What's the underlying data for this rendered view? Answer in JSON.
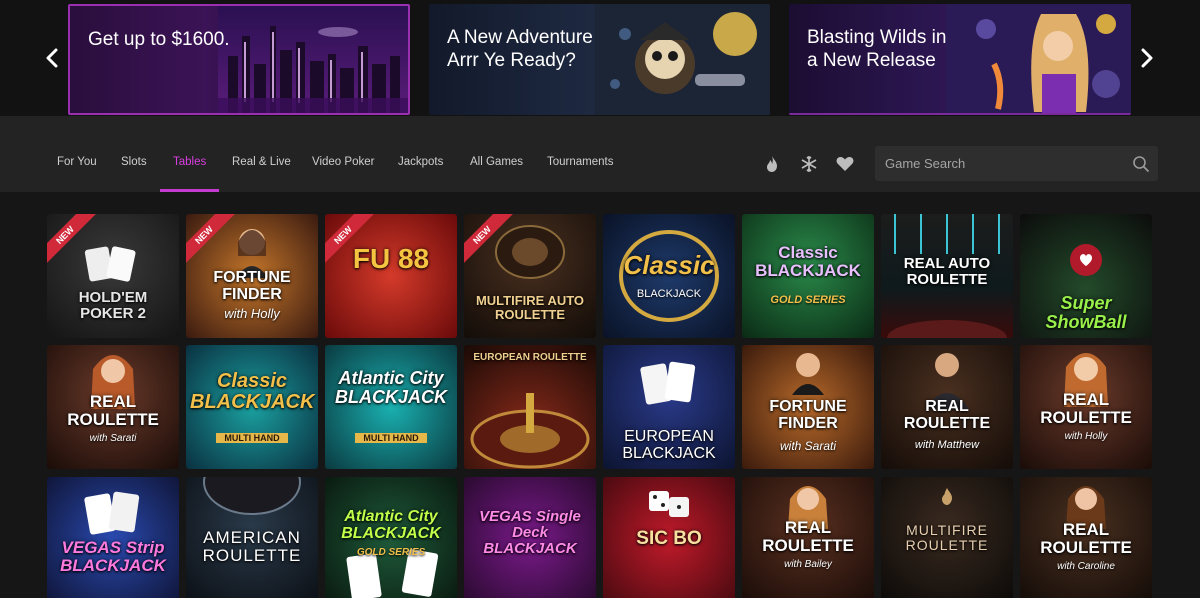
{
  "hero": {
    "prev_label": "Previous",
    "next_label": "Next",
    "banners": [
      {
        "text": "Get up to $1600."
      },
      {
        "text": "A New Adventure Arrr Ye Ready?"
      },
      {
        "text": "Blasting Wilds in a New Release"
      }
    ]
  },
  "nav": {
    "tabs": [
      {
        "label": "For You"
      },
      {
        "label": "Slots"
      },
      {
        "label": "Tables"
      },
      {
        "label": "Real & Live"
      },
      {
        "label": "Video Poker"
      },
      {
        "label": "Jackpots"
      },
      {
        "label": "All Games"
      },
      {
        "label": "Tournaments"
      }
    ],
    "active_tab": "Tables",
    "icons": [
      "flame-icon",
      "snowflake-icon",
      "heart-icon"
    ],
    "search_placeholder": "Game Search"
  },
  "tiles": [
    {
      "title": "HOLD'EM POKER 2",
      "sub": "",
      "badge": "NEW"
    },
    {
      "title": "FORTUNE FINDER",
      "sub": "with Holly",
      "badge": "NEW"
    },
    {
      "title": "FU 88",
      "sub": "",
      "badge": "NEW"
    },
    {
      "title": "MULTIFIRE AUTO ROULETTE",
      "sub": "",
      "badge": "NEW"
    },
    {
      "title": "Classic",
      "sub": "BLACKJACK",
      "badge": ""
    },
    {
      "title": "Classic BLACKJACK",
      "sub": "GOLD SERIES",
      "badge": ""
    },
    {
      "title": "REAL AUTO ROULETTE",
      "sub": "",
      "badge": ""
    },
    {
      "title": "Super ShowBall",
      "sub": "",
      "badge": ""
    },
    {
      "title": "REAL ROULETTE",
      "sub": "with Sarati",
      "badge": ""
    },
    {
      "title": "Classic BLACKJACK",
      "sub": "MULTI HAND",
      "badge": ""
    },
    {
      "title": "Atlantic City BLACKJACK",
      "sub": "MULTI HAND",
      "badge": ""
    },
    {
      "title": "EUROPEAN ROULETTE",
      "sub": "",
      "badge": ""
    },
    {
      "title": "EUROPEAN BLACKJACK",
      "sub": "",
      "badge": ""
    },
    {
      "title": "FORTUNE FINDER",
      "sub": "with Sarati",
      "badge": ""
    },
    {
      "title": "REAL ROULETTE",
      "sub": "with Matthew",
      "badge": ""
    },
    {
      "title": "REAL ROULETTE",
      "sub": "with Holly",
      "badge": ""
    },
    {
      "title": "VEGAS Strip BLACKJACK",
      "sub": "",
      "badge": ""
    },
    {
      "title": "AMERICAN ROULETTE",
      "sub": "",
      "badge": ""
    },
    {
      "title": "Atlantic City BLACKJACK",
      "sub": "GOLD SERIES",
      "badge": ""
    },
    {
      "title": "VEGAS Single Deck BLACKJACK",
      "sub": "",
      "badge": ""
    },
    {
      "title": "SIC BO",
      "sub": "",
      "badge": ""
    },
    {
      "title": "REAL ROULETTE",
      "sub": "with Bailey",
      "badge": ""
    },
    {
      "title": "MULTIFIRE ROULETTE",
      "sub": "",
      "badge": ""
    },
    {
      "title": "REAL ROULETTE",
      "sub": "with Caroline",
      "badge": ""
    }
  ],
  "colors": {
    "accent": "#c43bd0",
    "background": "#161616",
    "navbar": "#232323"
  }
}
